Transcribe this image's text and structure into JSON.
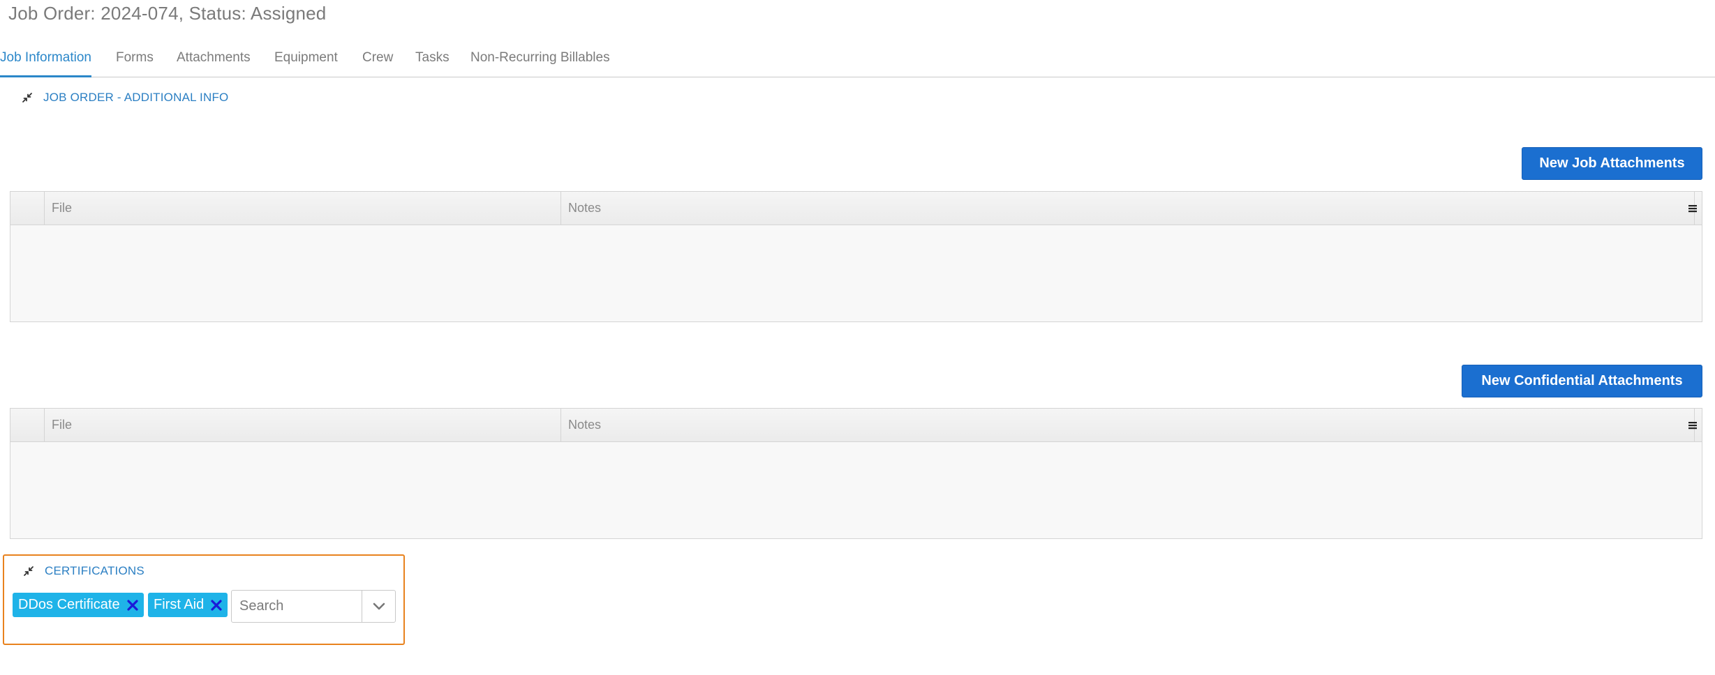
{
  "header": {
    "title": "Job Order: 2024-074, Status: Assigned"
  },
  "tabs": [
    {
      "label": "Job Information",
      "active": true
    },
    {
      "label": "Forms",
      "active": false
    },
    {
      "label": "Attachments",
      "active": false
    },
    {
      "label": "Equipment",
      "active": false
    },
    {
      "label": "Crew",
      "active": false
    },
    {
      "label": "Tasks",
      "active": false
    },
    {
      "label": "Non-Recurring Billables",
      "active": false
    }
  ],
  "additional_info": {
    "title": "JOB ORDER - ADDITIONAL INFO",
    "icon": "collapse-icon"
  },
  "job_attachments": {
    "button_label": "New Job Attachments",
    "columns": [
      "File",
      "Notes"
    ],
    "rows": []
  },
  "confidential_attachments": {
    "button_label": "New Confidential Attachments",
    "columns": [
      "File",
      "Notes"
    ],
    "rows": []
  },
  "certifications": {
    "title": "CERTIFICATIONS",
    "tags": [
      "DDos Certificate",
      "First Aid"
    ],
    "search_placeholder": "Search"
  },
  "colors": {
    "accent": "#2b87c9",
    "button": "#1b6fd0",
    "tag": "#1fb3e8",
    "highlight_border": "#e8821e"
  }
}
